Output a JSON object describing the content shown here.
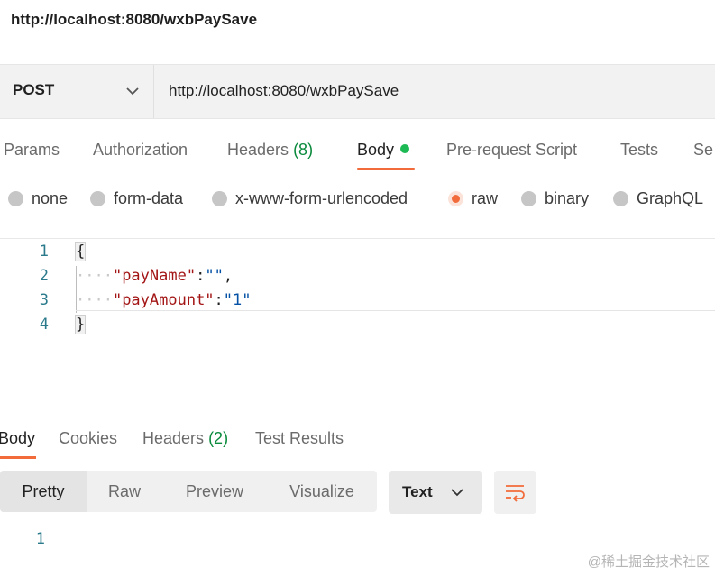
{
  "page_title": "http://localhost:8080/wxbPaySave",
  "request": {
    "method": "POST",
    "url": "http://localhost:8080/wxbPaySave"
  },
  "request_tabs": [
    {
      "label": "Params"
    },
    {
      "label": "Authorization"
    },
    {
      "label": "Headers",
      "count": "(8)"
    },
    {
      "label": "Body"
    },
    {
      "label": "Pre-request Script"
    },
    {
      "label": "Tests"
    },
    {
      "label": "Se"
    }
  ],
  "body_types": [
    "none",
    "form-data",
    "x-www-form-urlencoded",
    "raw",
    "binary",
    "GraphQL"
  ],
  "body_type_selected": "raw",
  "editor": {
    "line_numbers": [
      "1",
      "2",
      "3",
      "4"
    ],
    "open_brace": "{",
    "close_brace": "}",
    "indent": "····",
    "line2": {
      "key": "\"payName\"",
      "colon": ":",
      "value": "\"\"",
      "comma": ","
    },
    "line3": {
      "key": "\"payAmount\"",
      "colon": ":",
      "value": "\"1\""
    }
  },
  "response_tabs": [
    {
      "label": "Body"
    },
    {
      "label": "Cookies"
    },
    {
      "label": "Headers",
      "count": "(2)"
    },
    {
      "label": "Test Results"
    }
  ],
  "view_modes": [
    "Pretty",
    "Raw",
    "Preview",
    "Visualize"
  ],
  "view_mode_selected": "Pretty",
  "format": "Text",
  "response_line_numbers": [
    "1"
  ],
  "watermark": "@稀土掘金技术社区",
  "colors": {
    "accent": "#f26b3a",
    "status_green": "#1db954"
  }
}
